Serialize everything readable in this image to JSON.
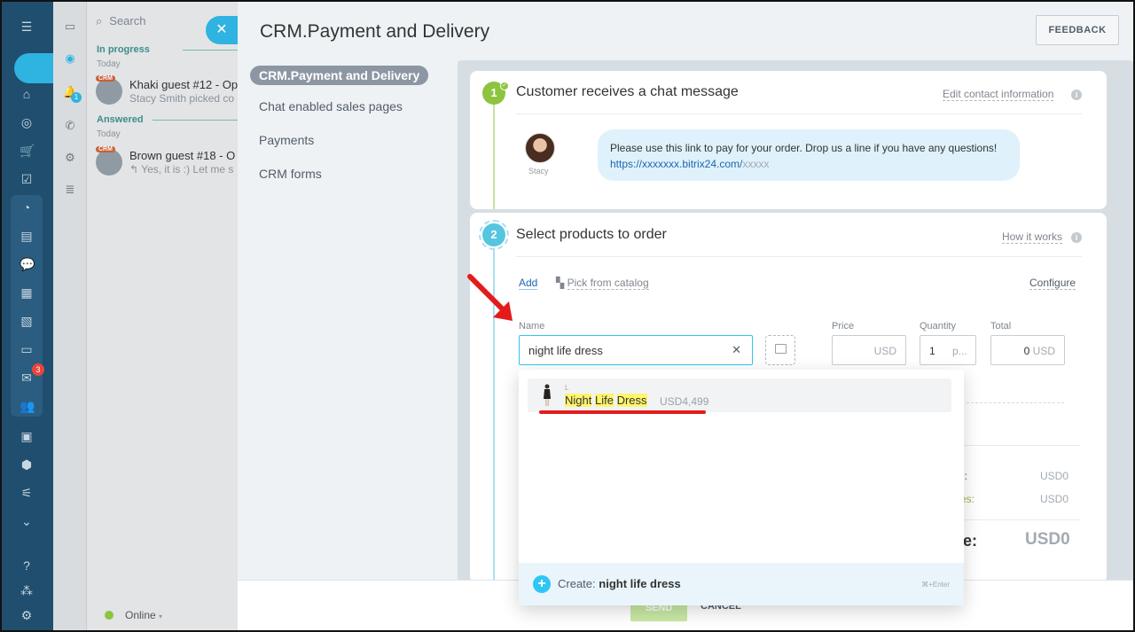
{
  "sidebar": {
    "mail_badge": "3"
  },
  "chat": {
    "search_placeholder": "Search",
    "section_in_progress": "In progress",
    "section_answered": "Answered",
    "day_label": "Today",
    "notif_badge": "1",
    "crm_tag": "CRM",
    "items": [
      {
        "title": "Khaki guest #12 - Op",
        "preview": "Stacy Smith picked co"
      },
      {
        "title": "Brown guest #18 - O",
        "preview": "↰ Yes, it is :) Let me s"
      }
    ],
    "status": "Online"
  },
  "panel": {
    "title": "CRM.Payment and Delivery",
    "feedback_label": "FEEDBACK",
    "nav": [
      {
        "label": "CRM.Payment and Delivery"
      },
      {
        "label": "Chat enabled sales pages"
      },
      {
        "label": "Payments"
      },
      {
        "label": "CRM forms"
      }
    ]
  },
  "step1": {
    "number": "1",
    "title": "Customer receives a chat message",
    "link": "Edit contact information",
    "agent_name": "Stacy",
    "message": "Please use this link to pay for your order. Drop us a line if you have any questions!",
    "message_link": "https://xxxxxxx.bitrix24.com/",
    "message_link_tail": "xxxxx"
  },
  "step2": {
    "number": "2",
    "title": "Select products to order",
    "link": "How it works",
    "add_label": "Add",
    "catalog_label": "Pick from catalog",
    "configure_label": "Configure",
    "col_name": "Name",
    "col_price": "Price",
    "col_quantity": "Quantity",
    "col_total": "Total",
    "name_value": "night life dress",
    "price_currency": "USD",
    "quantity_value": "1",
    "quantity_unit": "p...",
    "total_value": "0",
    "total_currency": "USD",
    "totals": [
      {
        "label": "tal:",
        "value": "USD0"
      },
      {
        "label": "es:",
        "value": "USD0"
      },
      {
        "label": "e:",
        "value": "USD0"
      }
    ]
  },
  "dropdown": {
    "result": {
      "caption": "L",
      "name_parts": [
        "Night",
        "Life",
        "Dress"
      ],
      "price": "USD4,499"
    },
    "create_prefix": "Create:",
    "create_value": "night life dress",
    "create_hint": "⌘+Enter"
  },
  "footer": {
    "send_label": "SEND",
    "cancel_label": "CANCEL"
  },
  "colors": {
    "accent": "#2fc6f6",
    "step1": "#8cc43f",
    "step2": "#55c5e0",
    "annotation": "#e31b1b"
  }
}
